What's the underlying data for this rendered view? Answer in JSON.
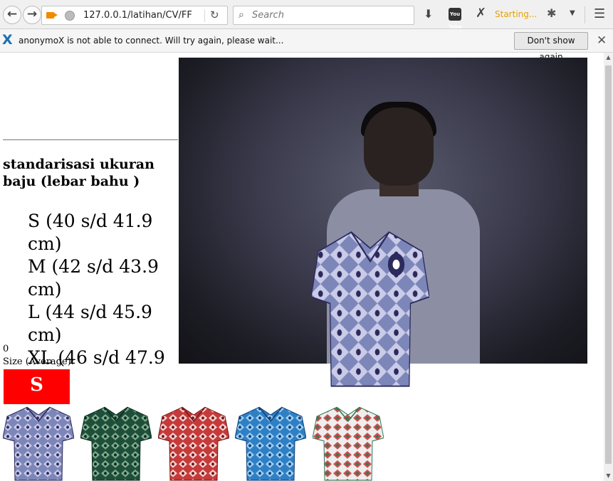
{
  "browser": {
    "url": "127.0.0.1/latihan/CV/FF",
    "search_placeholder": "Search",
    "addon_status": "Starting...",
    "youtube_icon_text": "You Tube"
  },
  "notification": {
    "message": "anonymoX is not able to connect. Will try again, please wait...",
    "button": "Don't show again"
  },
  "page": {
    "heading": "standarisasi ukuran baju (lebar bahu )",
    "sizes": [
      "S (40 s/d 41.9 cm)",
      "M (42 s/d 43.9 cm)",
      "L (44 s/d 45.9 cm)",
      "XL (46 s/d 47.9 cm)"
    ],
    "counter": "0",
    "size_label": "Size (Average):",
    "size_value": "S",
    "size_color": "#ff0000"
  },
  "shirts": [
    {
      "name": "batik-blue-purple",
      "base": "#7d86b8",
      "accent": "#2c2a5c",
      "pattern": "#c9cbe8"
    },
    {
      "name": "batik-green",
      "base": "#1f4f3a",
      "accent": "#0d2a1f",
      "pattern": "#7fae8e"
    },
    {
      "name": "batik-red",
      "base": "#c63a3a",
      "accent": "#7a1414",
      "pattern": "#f2d6d6"
    },
    {
      "name": "batik-blue",
      "base": "#2f7fc4",
      "accent": "#0f3f7a",
      "pattern": "#9fd0f2"
    },
    {
      "name": "batik-white-floral",
      "base": "#eeeeee",
      "accent": "#2f7a55",
      "pattern": "#d24a4a"
    }
  ]
}
